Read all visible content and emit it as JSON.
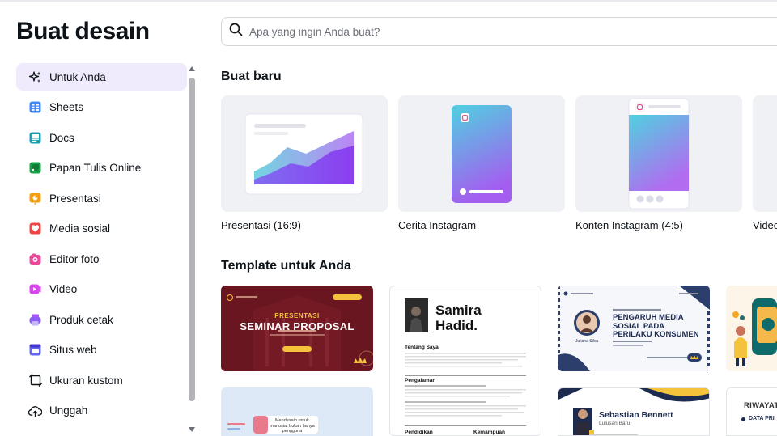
{
  "page": {
    "title": "Buat desain"
  },
  "search": {
    "placeholder": "Apa yang ingin Anda buat?"
  },
  "sidebar": {
    "items": [
      {
        "label": "Untuk Anda",
        "icon": "sparkle-icon",
        "active": true
      },
      {
        "label": "Sheets",
        "icon": "sheets-icon"
      },
      {
        "label": "Docs",
        "icon": "docs-icon"
      },
      {
        "label": "Papan Tulis Online",
        "icon": "whiteboard-icon"
      },
      {
        "label": "Presentasi",
        "icon": "presentation-icon"
      },
      {
        "label": "Media sosial",
        "icon": "heart-icon"
      },
      {
        "label": "Editor foto",
        "icon": "camera-icon"
      },
      {
        "label": "Video",
        "icon": "video-icon"
      },
      {
        "label": "Produk cetak",
        "icon": "printer-icon"
      },
      {
        "label": "Situs web",
        "icon": "website-icon"
      },
      {
        "label": "Ukuran kustom",
        "icon": "custom-size-icon"
      },
      {
        "label": "Unggah",
        "icon": "upload-cloud-icon"
      }
    ]
  },
  "new_section": {
    "title": "Buat baru",
    "cards": [
      {
        "label": "Presentasi (16:9)"
      },
      {
        "label": "Cerita Instagram"
      },
      {
        "label": "Konten Instagram (4:5)"
      },
      {
        "label": "Video"
      }
    ]
  },
  "template_section": {
    "title": "Template untuk Anda",
    "templates": [
      {
        "name": "seminar-proposal",
        "line1": "PRESENTASI",
        "line2": "SEMINAR PROPOSAL"
      },
      {
        "name": "resume-samira",
        "name_line1": "Samira",
        "name_line2": "Hadid.",
        "heading1": "Tentang Saya",
        "heading2": "Pengalaman",
        "heading3": "Pendidikan",
        "heading4": "Kemampuan"
      },
      {
        "name": "pengaruh-media",
        "line1": "PENGARUH MEDIA",
        "line2": "SOSIAL PADA",
        "line3": "PERILAKU KONSUMEN",
        "person": "Juliana Silva"
      },
      {
        "name": "illustration-template"
      },
      {
        "name": "blue-template",
        "quote": "Mendesain untuk manusia, bukan hanya pengguna"
      },
      {
        "name": "resume-sebastian",
        "person": "Sebastian Bennett",
        "subtitle": "Lulusan Baru"
      },
      {
        "name": "riwayat",
        "title": "RIWAYAT",
        "item": "DATA PRI"
      }
    ]
  },
  "colors": {
    "accent": "#7d2ae8",
    "active_bg": "#efeafc"
  }
}
